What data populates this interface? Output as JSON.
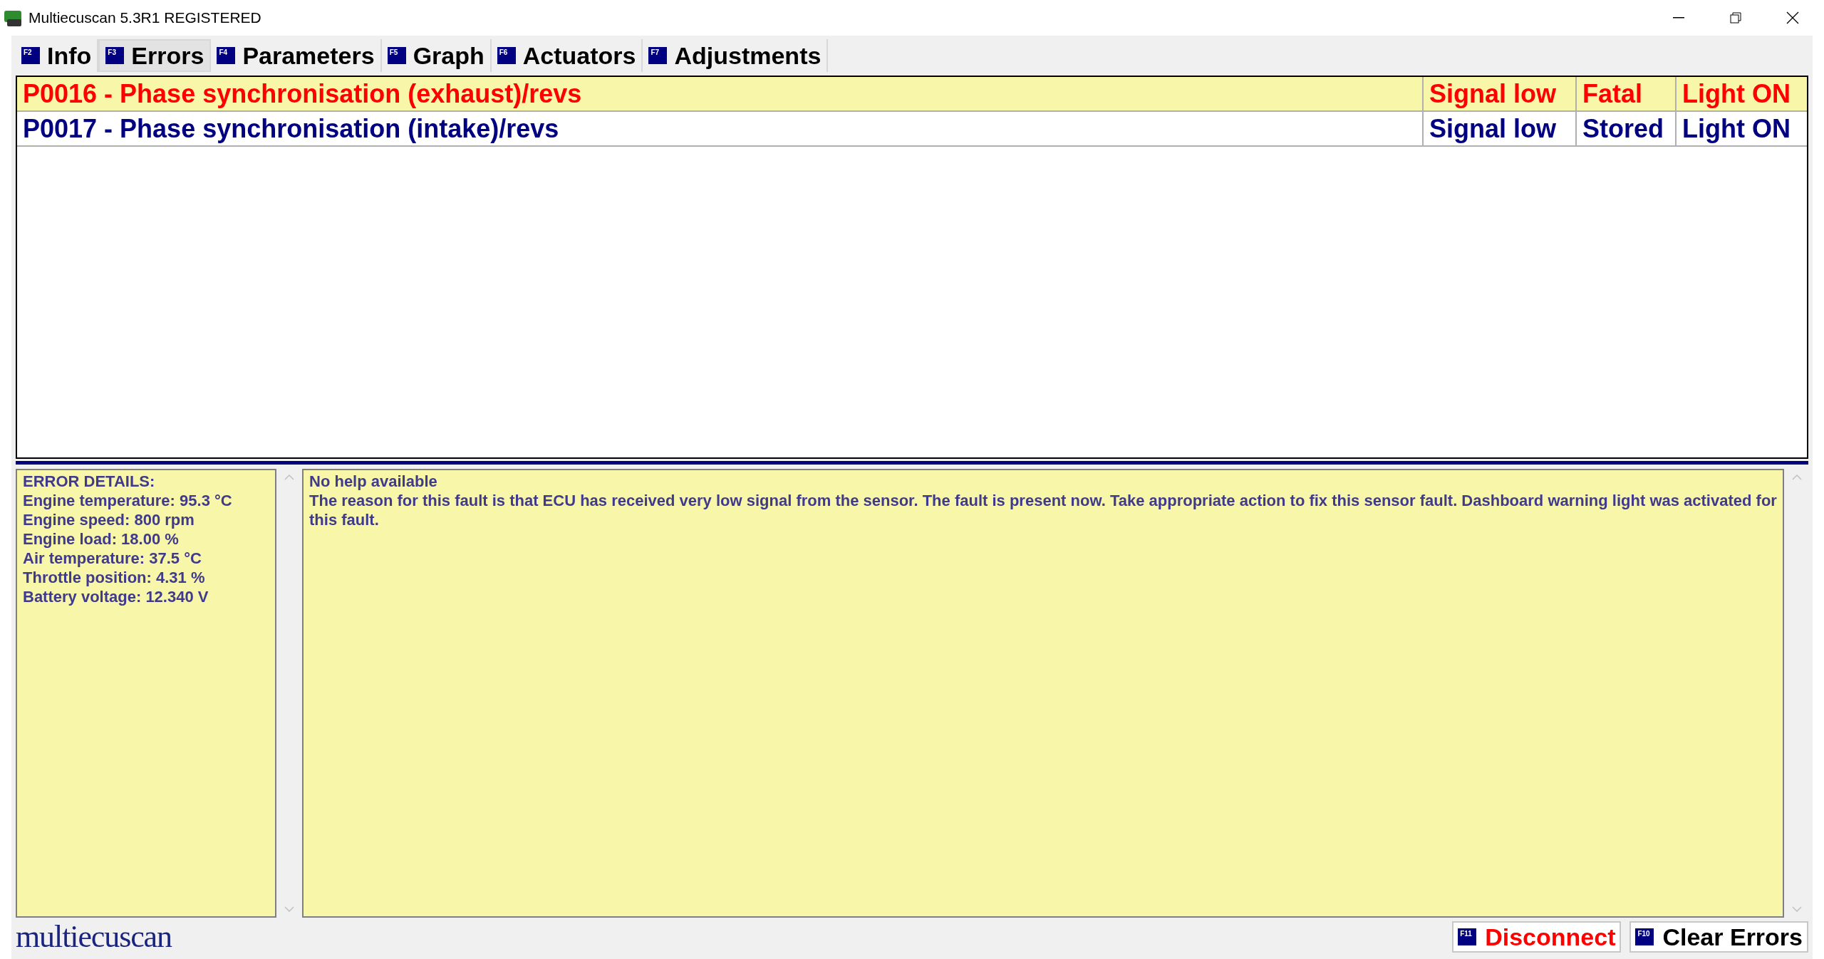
{
  "window": {
    "title": "Multiecuscan 5.3R1 REGISTERED"
  },
  "tabs": [
    {
      "key": "F2",
      "label": "Info",
      "selected": false
    },
    {
      "key": "F3",
      "label": "Errors",
      "selected": true
    },
    {
      "key": "F4",
      "label": "Parameters",
      "selected": false
    },
    {
      "key": "F5",
      "label": "Graph",
      "selected": false
    },
    {
      "key": "F6",
      "label": "Actuators",
      "selected": false
    },
    {
      "key": "F7",
      "label": "Adjustments",
      "selected": false
    }
  ],
  "errors": [
    {
      "description": "P0016 - Phase synchronisation (exhaust)/revs",
      "condition": "Signal low",
      "status": "Fatal",
      "light": "Light ON",
      "present": true,
      "selected": true
    },
    {
      "description": "P0017 - Phase synchronisation (intake)/revs",
      "condition": "Signal low",
      "status": "Stored",
      "light": "Light ON",
      "present": false,
      "selected": false
    }
  ],
  "error_details": [
    "ERROR DETAILS:",
    "Engine temperature: 95.3 °C",
    "Engine speed: 800 rpm",
    "Engine load: 18.00 %",
    "Air temperature: 37.5 °C",
    "Throttle position: 4.31 %",
    "Battery voltage: 12.340 V"
  ],
  "help": [
    "No help available",
    "The reason for this fault is that ECU has received very low signal from the sensor. The fault is present now. Take appropriate action to fix this sensor fault. Dashboard warning light was activated for this fault."
  ],
  "logo": "multiecuscan",
  "buttons": [
    {
      "key": "F11",
      "label": "Disconnect",
      "color": "#ff0000"
    },
    {
      "key": "F10",
      "label": "Clear Errors",
      "color": "#000000"
    }
  ]
}
